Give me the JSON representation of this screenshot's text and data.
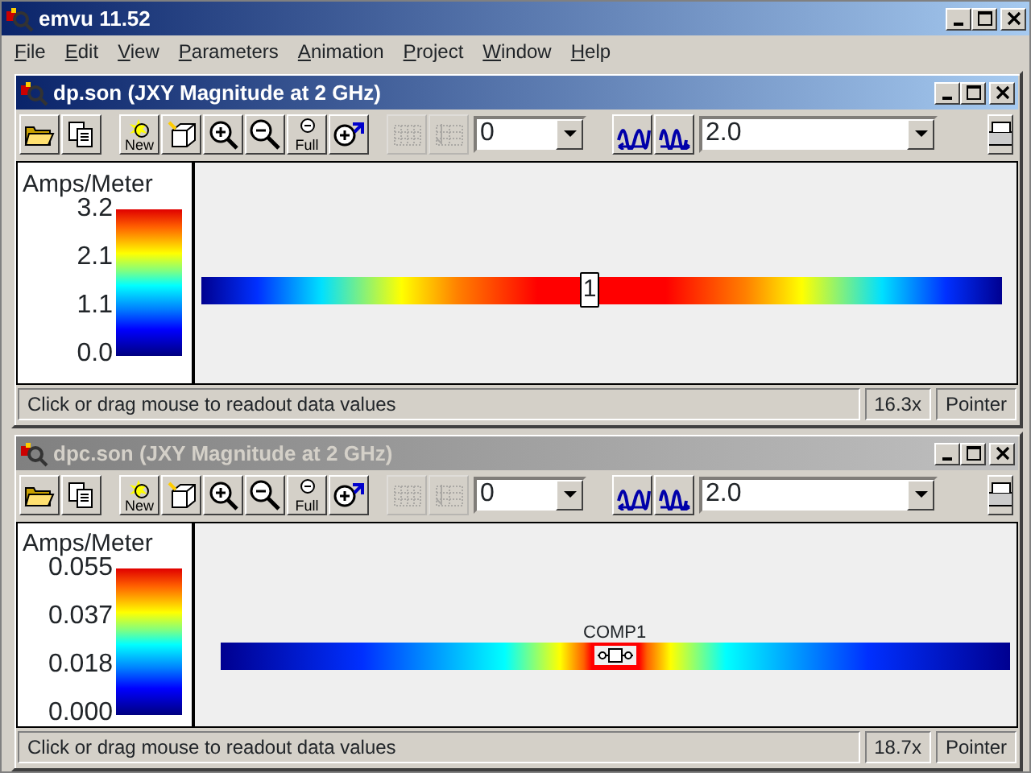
{
  "window": {
    "title": "emvu 11.52"
  },
  "menu": [
    {
      "label": "File"
    },
    {
      "label": "Edit"
    },
    {
      "label": "View"
    },
    {
      "label": "Parameters"
    },
    {
      "label": "Animation"
    },
    {
      "label": "Project"
    },
    {
      "label": "Window"
    },
    {
      "label": "Help"
    }
  ],
  "documents": [
    {
      "title": "dp.son (JXY Magnitude at 2 GHz)",
      "active": true,
      "toolbar": [
        {
          "kind": "button",
          "disabled": false
        },
        {
          "kind": "button",
          "disabled": false
        },
        {
          "kind": "button",
          "label": "New",
          "disabled": false
        },
        {
          "kind": "button",
          "disabled": false
        },
        {
          "kind": "button",
          "disabled": false
        },
        {
          "kind": "button",
          "disabled": false
        },
        {
          "kind": "button",
          "label": "Full",
          "disabled": false
        },
        {
          "kind": "button",
          "disabled": false
        },
        {
          "kind": "button",
          "disabled": true
        },
        {
          "kind": "button",
          "disabled": true
        },
        {
          "kind": "combo",
          "value": "0"
        },
        {
          "kind": "button",
          "disabled": false
        },
        {
          "kind": "button",
          "disabled": false
        },
        {
          "kind": "combo",
          "value": "2.0"
        },
        {
          "kind": "button",
          "disabled": false
        }
      ],
      "legend": {
        "title": "Amps/Meter",
        "ticks": [
          "3.2",
          "2.1",
          "1.1",
          "0.0"
        ]
      },
      "strip": {
        "kind": "port",
        "label": "1"
      },
      "status": {
        "message": "Click or drag mouse to readout data values",
        "zoom": "16.3x",
        "mode": "Pointer"
      }
    },
    {
      "title": "dpc.son (JXY Magnitude at 2 GHz)",
      "active": false,
      "toolbar": [
        {
          "kind": "button",
          "disabled": false
        },
        {
          "kind": "button",
          "disabled": false
        },
        {
          "kind": "button",
          "label": "New",
          "disabled": false
        },
        {
          "kind": "button",
          "disabled": false
        },
        {
          "kind": "button",
          "disabled": false
        },
        {
          "kind": "button",
          "disabled": false
        },
        {
          "kind": "button",
          "label": "Full",
          "disabled": false
        },
        {
          "kind": "button",
          "disabled": false
        },
        {
          "kind": "button",
          "disabled": true
        },
        {
          "kind": "button",
          "disabled": true
        },
        {
          "kind": "combo",
          "value": "0"
        },
        {
          "kind": "button",
          "disabled": false
        },
        {
          "kind": "button",
          "disabled": false
        },
        {
          "kind": "combo",
          "value": "2.0"
        },
        {
          "kind": "button",
          "disabled": false
        }
      ],
      "legend": {
        "title": "Amps/Meter",
        "ticks": [
          "0.055",
          "0.037",
          "0.018",
          "0.000"
        ]
      },
      "strip": {
        "kind": "component",
        "label": "COMP1"
      },
      "status": {
        "message": "Click or drag mouse to readout data values",
        "zoom": "18.7x",
        "mode": "Pointer"
      }
    }
  ]
}
